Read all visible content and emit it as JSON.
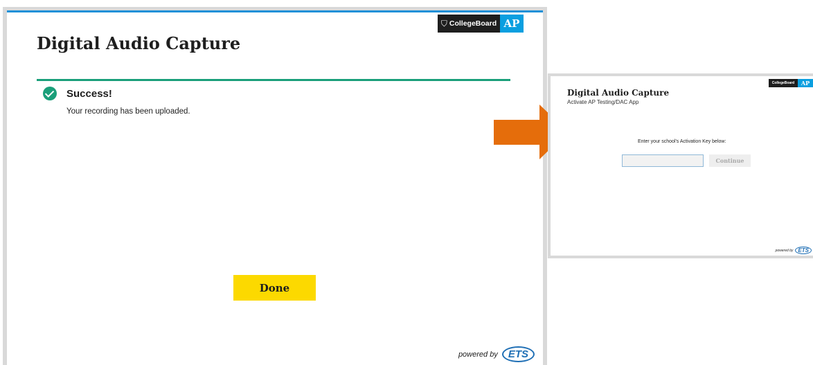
{
  "main_window": {
    "brand": {
      "collegeboard_label": "CollegeBoard",
      "ap_label": "AP"
    },
    "title": "Digital Audio Capture",
    "success_title": "Success!",
    "success_message": "Your recording has been uploaded.",
    "done_button": "Done",
    "powered_by": "powered by",
    "ets_logo": "ETS"
  },
  "activation_window": {
    "brand": {
      "collegeboard_label": "CollegeBoard",
      "ap_label": "AP"
    },
    "title": "Digital Audio Capture",
    "subtitle": "Activate AP Testing/DAC App",
    "prompt": "Enter your school's Activation Key below:",
    "key_input_value": "",
    "continue_button": "Continue",
    "powered_by": "powered by",
    "ets_logo": "ETS"
  },
  "colors": {
    "accent_blue": "#1a90d8",
    "success_green": "#1a9f7a",
    "done_yellow": "#fcd900",
    "arrow_orange": "#e56d0b"
  },
  "icons": [
    "collegeboard-shield-icon",
    "success-check-icon",
    "right-arrow-icon",
    "ets-logo-icon"
  ]
}
